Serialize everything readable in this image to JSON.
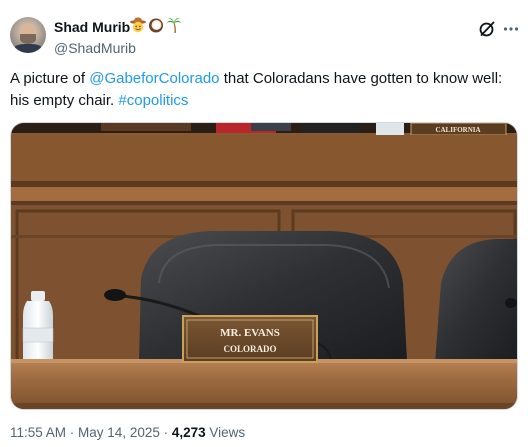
{
  "author": {
    "display_name": "Shad Murib",
    "handle": "@ShadMurib",
    "name_emojis": [
      "cowboy-face-emoji",
      "coconut-emoji",
      "palm-tree-emoji"
    ]
  },
  "actions": {
    "grok_icon": "grok-slash-circle-icon",
    "more_icon": "more-dots-icon"
  },
  "tweet": {
    "text_parts": {
      "p1": "A picture of ",
      "mention": "@GabeforColorado",
      "p2": " that Coloradans have gotten to know well: his empty chair. ",
      "hashtag": "#copolitics"
    }
  },
  "media": {
    "nameplate_line1": "MR. EVANS",
    "nameplate_line2": "COLORADO",
    "background_plate": "CALIFORNIA"
  },
  "meta": {
    "time": "11:55 AM",
    "sep1": " · ",
    "date": "May 14, 2025",
    "sep2": " · ",
    "views_count": "4,273",
    "views_label": " Views"
  },
  "colors": {
    "link": "#1d9bf0",
    "secondary_text": "#536471",
    "primary_text": "#0f1419"
  }
}
